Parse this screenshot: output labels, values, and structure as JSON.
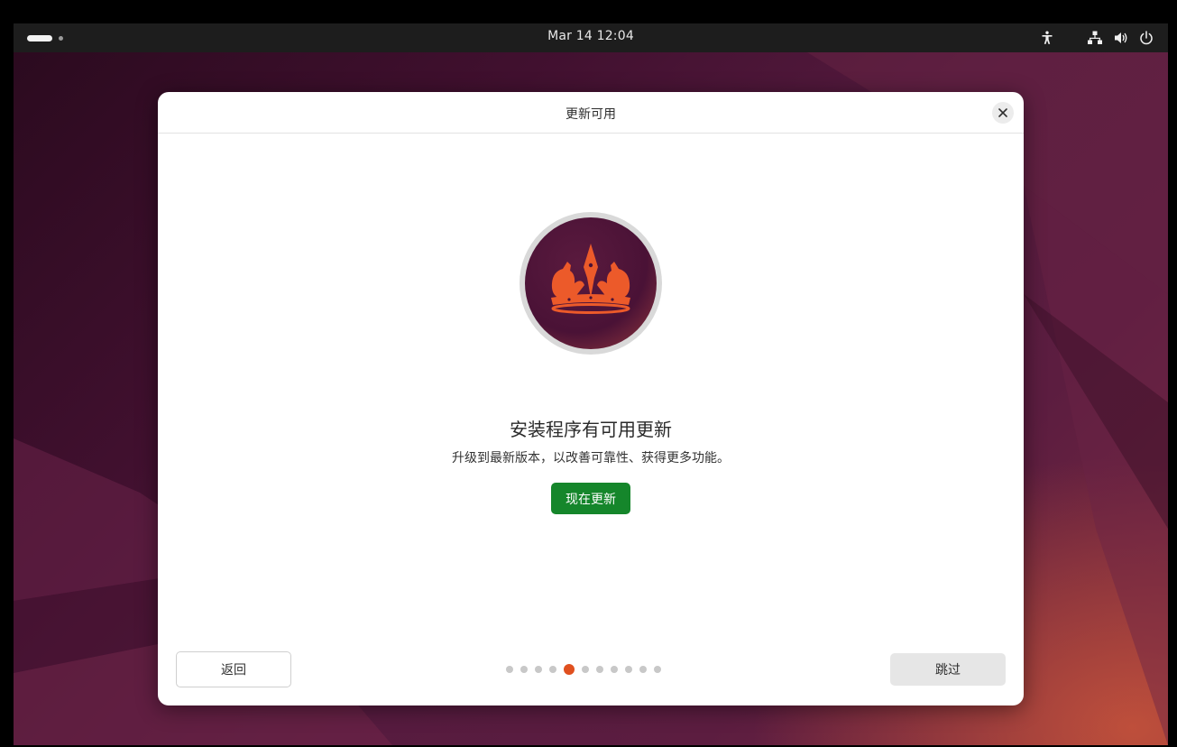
{
  "topbar": {
    "clock": "Mar 14  12:04",
    "icons": [
      "accessibility-icon",
      "network-icon",
      "volume-icon",
      "power-icon"
    ]
  },
  "dialog": {
    "title": "更新可用",
    "close_icon": "close-icon",
    "logo": "ubuntu-noble-numbat-crown-logo",
    "heading": "安装程序有可用更新",
    "description": "升级到最新版本，以改善可靠性、获得更多功能。",
    "update_button": "现在更新",
    "back_button": "返回",
    "skip_button": "跳过",
    "pager": {
      "total": 11,
      "active_index": 4
    }
  },
  "colors": {
    "accent": "#e0501f",
    "update_button": "#15862b",
    "topbar": "#1d1d1d",
    "wallpaper": "#561b3f"
  }
}
